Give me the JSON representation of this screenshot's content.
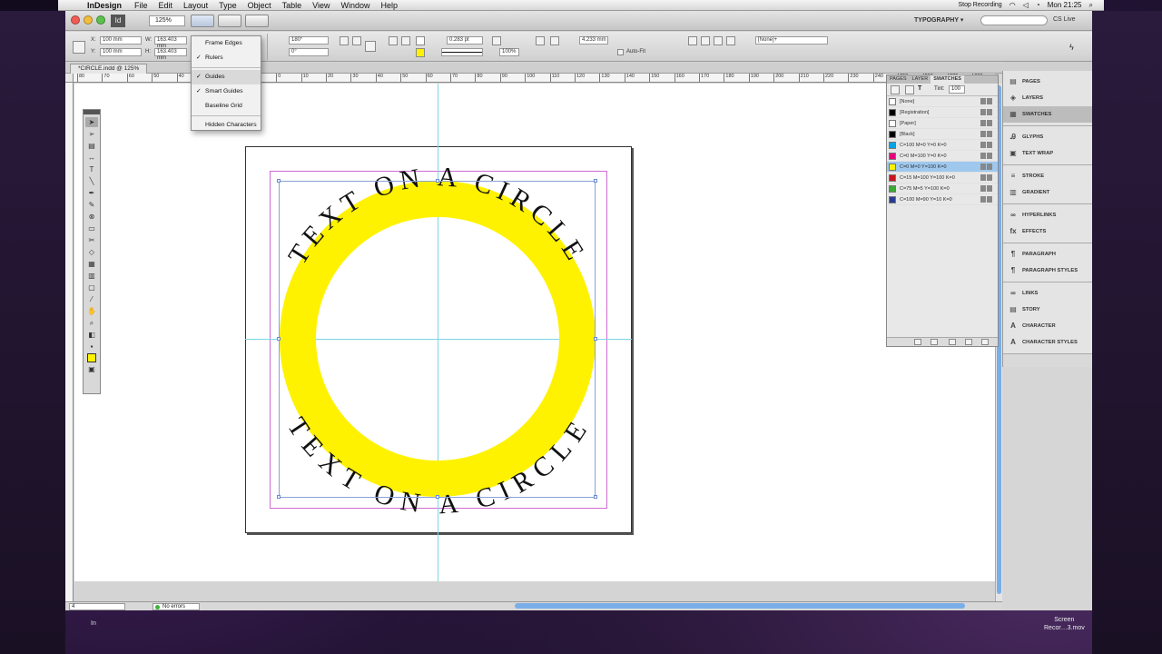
{
  "menubar": {
    "app_name": "InDesign",
    "menus": [
      "File",
      "Edit",
      "Layout",
      "Type",
      "Object",
      "Table",
      "View",
      "Window",
      "Help"
    ],
    "stop_recording": "Stop Recording",
    "clock": "Mon 21:25"
  },
  "appbar": {
    "logo": "Id",
    "zoom": "125%",
    "workspace": "TYPOGRAPHY ▾",
    "cs_live": "CS Live"
  },
  "control": {
    "x_label": "X:",
    "y_label": "Y:",
    "w_label": "W:",
    "h_label": "H:",
    "x_value": "100 mm",
    "y_value": "100 mm",
    "w_value": "163.403 mm",
    "h_value": "163.403 mm",
    "rotate_value": "180°",
    "shear_value": "0°",
    "stroke_weight": "0.283 pt",
    "opacity": "100%",
    "corner_value": "4.233 mm",
    "autofit_label": "Auto-Fit",
    "style_value": "[None]+"
  },
  "document": {
    "tab_label": "*CIRCLE.indd @ 125%"
  },
  "ruler": {
    "labels": [
      "80",
      "70",
      "60",
      "50",
      "40",
      "30",
      "20",
      "10",
      "0",
      "10",
      "20",
      "30",
      "40",
      "50",
      "60",
      "70",
      "80",
      "90",
      "100",
      "110",
      "120",
      "130",
      "140",
      "150",
      "160",
      "170",
      "180",
      "190",
      "200",
      "210",
      "220",
      "230",
      "240",
      "250",
      "260",
      "270",
      "280",
      "290",
      "300"
    ]
  },
  "artwork": {
    "top_text": "TEXT ON A CIRCLE",
    "bottom_text": "TEXT ON A CIRCLE",
    "ring_color": "#fff200"
  },
  "view_menu": {
    "items": [
      {
        "label": "Frame Edges",
        "checked": ""
      },
      {
        "label": "Rulers",
        "checked": "✓"
      },
      {
        "label": "Guides",
        "checked": "✓"
      },
      {
        "label": "Smart Guides",
        "checked": "✓"
      },
      {
        "label": "Baseline Grid",
        "checked": ""
      },
      {
        "label": "Hidden Characters",
        "checked": ""
      }
    ]
  },
  "swatches_panel": {
    "tabs": [
      "PAGES",
      "LAYER",
      "SWATCHES"
    ],
    "tint_label": "Tint:",
    "tint_value": "100",
    "rows": [
      {
        "name": "[None]",
        "color": "#ffffff"
      },
      {
        "name": "[Registration]",
        "color": "#000000"
      },
      {
        "name": "[Paper]",
        "color": "#ffffff"
      },
      {
        "name": "[Black]",
        "color": "#000000"
      },
      {
        "name": "C=100 M=0 Y=0 K=0",
        "color": "#00a6e6"
      },
      {
        "name": "C=0 M=100 Y=0 K=0",
        "color": "#e6007e"
      },
      {
        "name": "C=0 M=0 Y=100 K=0",
        "color": "#fff200"
      },
      {
        "name": "C=15 M=100 Y=100 K=0",
        "color": "#c8161d"
      },
      {
        "name": "C=75 M=5 Y=100 K=0",
        "color": "#3aa935"
      },
      {
        "name": "C=100 M=90 Y=10 K=0",
        "color": "#2a3b8f"
      }
    ]
  },
  "dock": {
    "groups": [
      [
        "PAGES",
        "LAYERS",
        "SWATCHES"
      ],
      [
        "GLYPHS",
        "TEXT WRAP"
      ],
      [
        "STROKE",
        "GRADIENT"
      ],
      [
        "HYPERLINKS",
        "EFFECTS"
      ],
      [
        "PARAGRAPH",
        "PARAGRAPH STYLES"
      ],
      [
        "LINKS",
        "STORY",
        "CHARACTER",
        "CHARACTER STYLES"
      ]
    ]
  },
  "status": {
    "page": "4",
    "preflight": "No errors"
  },
  "desktop": {
    "bottom_left": "In",
    "screen_rec_line1": "Screen",
    "screen_rec_line2": "Recor…3.mov"
  }
}
